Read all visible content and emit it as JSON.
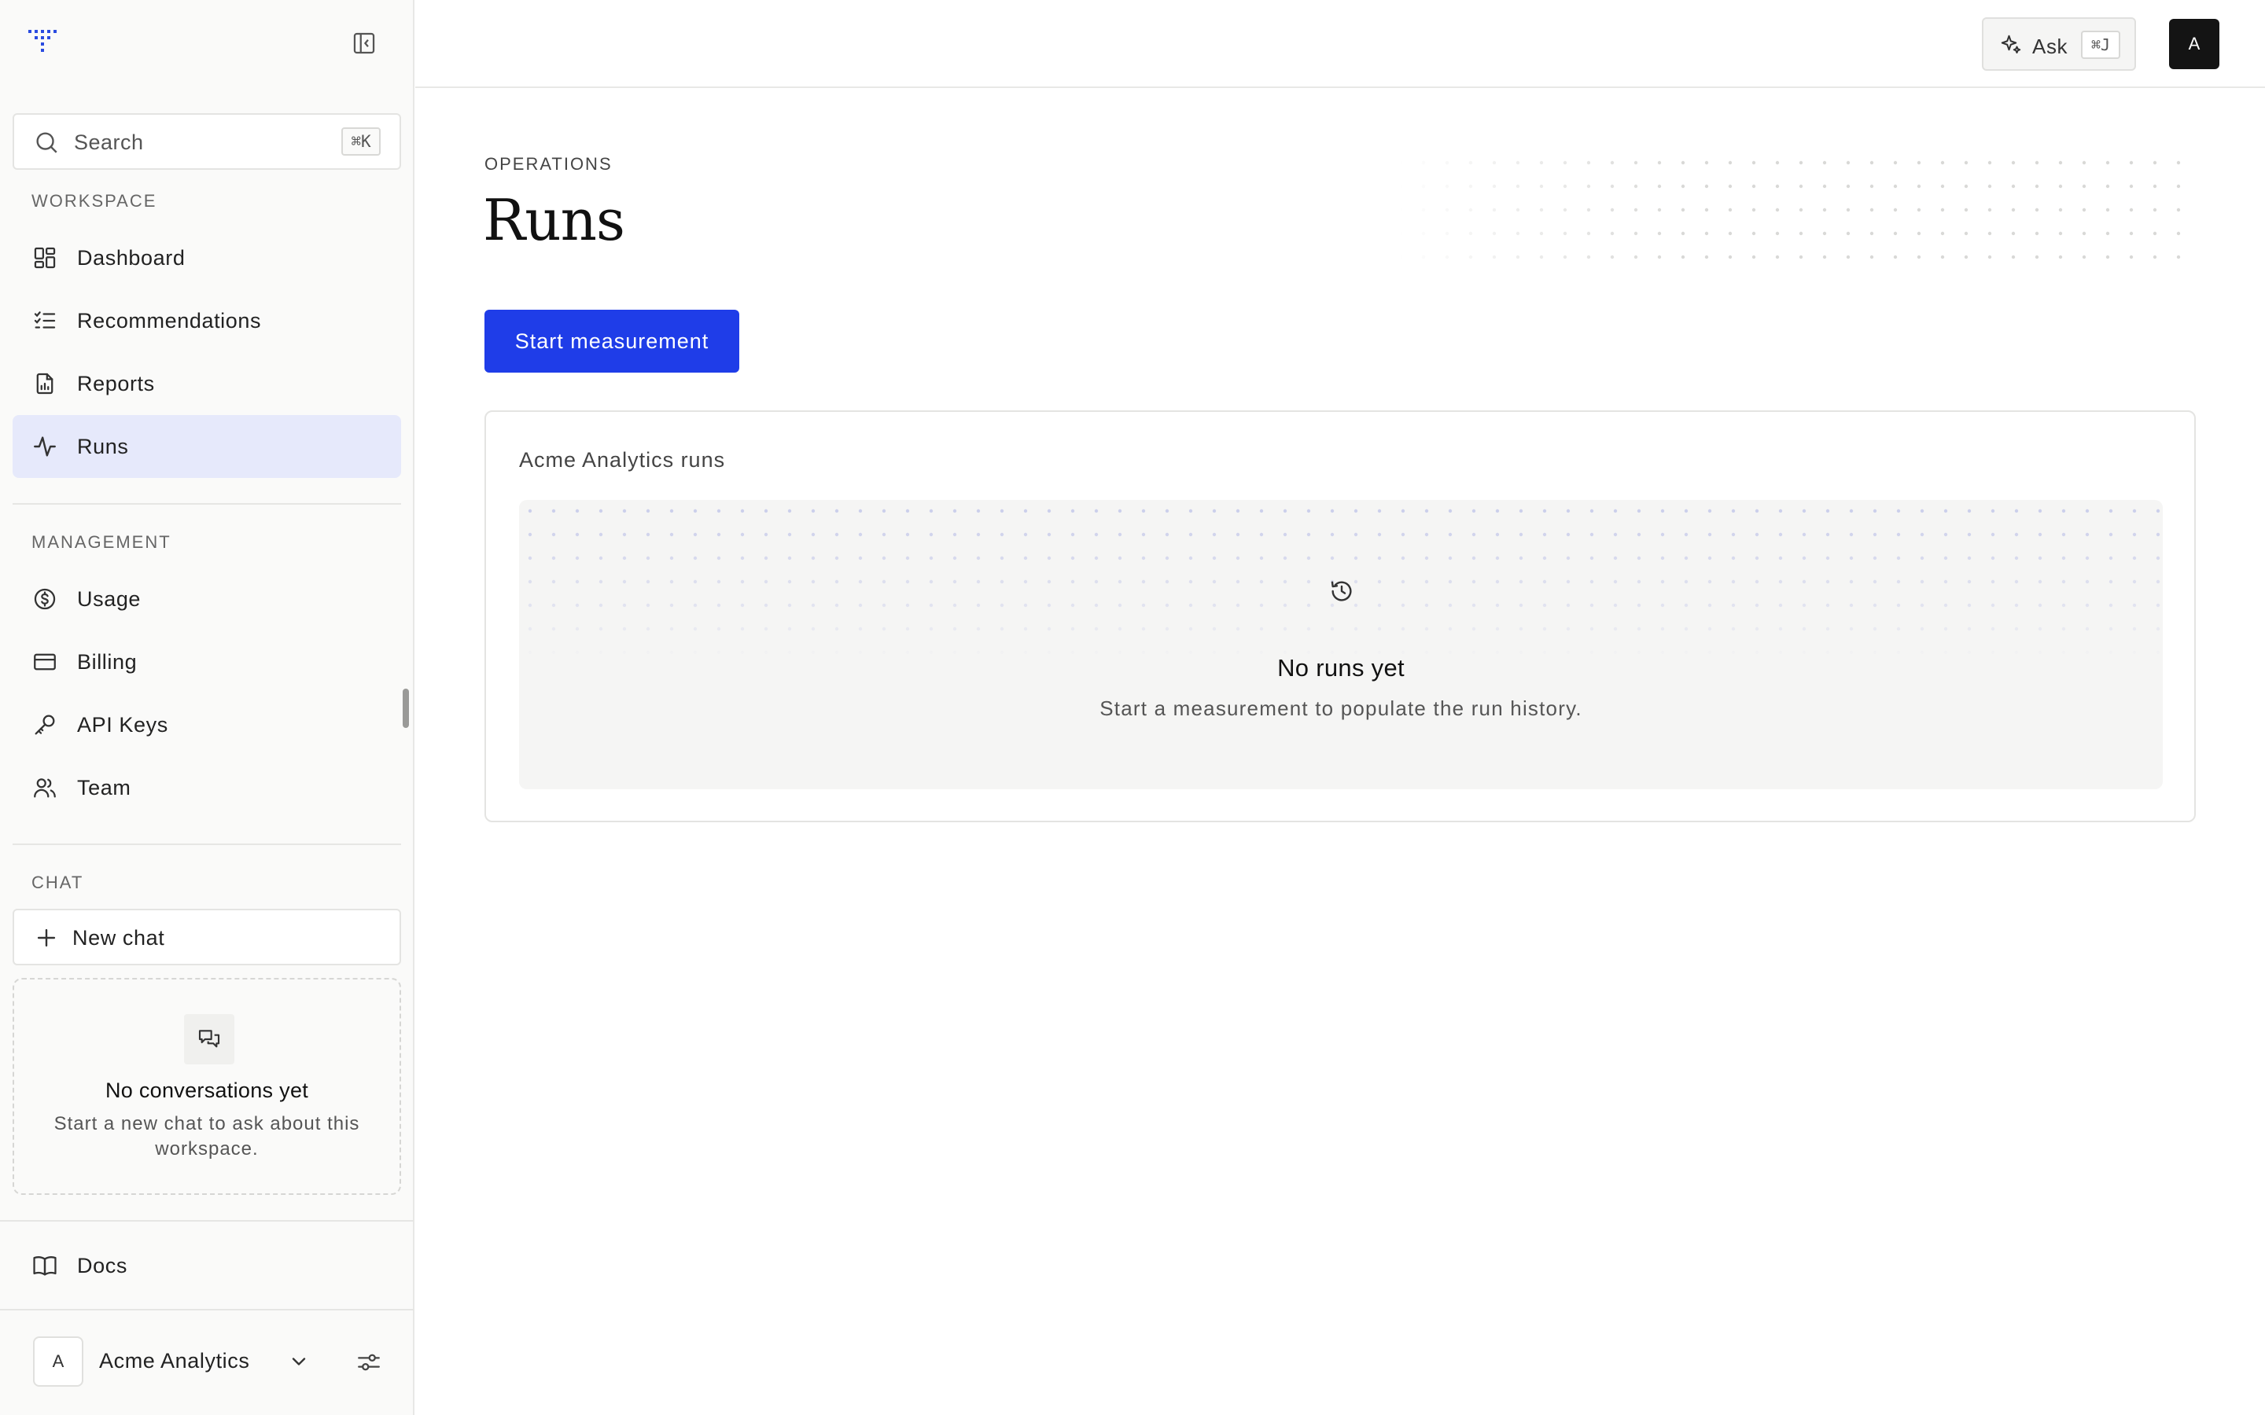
{
  "sidebar": {
    "search": {
      "placeholder": "Search",
      "shortcut": "⌘K"
    },
    "workspace_label": "WORKSPACE",
    "workspace_items": [
      {
        "label": "Dashboard",
        "icon": "dashboard-icon"
      },
      {
        "label": "Recommendations",
        "icon": "checklist-icon"
      },
      {
        "label": "Reports",
        "icon": "report-icon"
      },
      {
        "label": "Runs",
        "icon": "activity-icon",
        "active": true
      }
    ],
    "management_label": "MANAGEMENT",
    "management_items": [
      {
        "label": "Usage",
        "icon": "dollar-icon"
      },
      {
        "label": "Billing",
        "icon": "credit-card-icon"
      },
      {
        "label": "API Keys",
        "icon": "key-icon"
      },
      {
        "label": "Team",
        "icon": "users-icon"
      }
    ],
    "chat_label": "CHAT",
    "new_chat_label": "New chat",
    "chat_empty": {
      "title": "No conversations yet",
      "description": "Start a new chat to ask about this workspace."
    },
    "docs_label": "Docs",
    "account": {
      "initial": "A",
      "name": "Acme Analytics"
    }
  },
  "topbar": {
    "ask_label": "Ask",
    "ask_shortcut": "⌘J",
    "avatar_initial": "A"
  },
  "main": {
    "eyebrow": "OPERATIONS",
    "title": "Runs",
    "primary_action": "Start measurement",
    "card": {
      "title": "Acme Analytics runs",
      "empty_title": "No runs yet",
      "empty_description": "Start a measurement to populate the run history."
    }
  },
  "colors": {
    "accent": "#1f3de8",
    "active_nav_bg": "#e6e9fb",
    "sidebar_bg": "#fafaf9",
    "avatar_bg": "#141414"
  }
}
